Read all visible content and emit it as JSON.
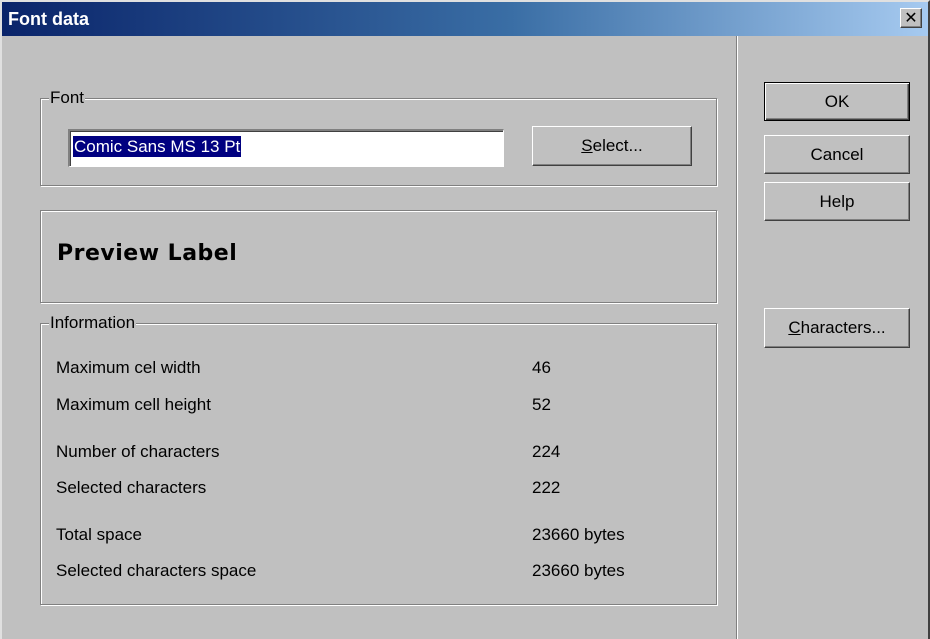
{
  "window": {
    "title": "Font data",
    "close_glyph": "✕"
  },
  "font_group": {
    "label": "Font",
    "font_value": "Comic Sans MS 13 Pt",
    "select_button": {
      "pre": "",
      "accel": "S",
      "post": "elect..."
    }
  },
  "preview": {
    "text": "Preview Label"
  },
  "info_group": {
    "label": "Information",
    "rows": [
      {
        "label": "Maximum cel width",
        "value": "46"
      },
      {
        "label": "Maximum cell height",
        "value": "52"
      },
      {
        "label": "Number of characters",
        "value": "224"
      },
      {
        "label": "Selected characters",
        "value": "222"
      },
      {
        "label": "Total space",
        "value": "23660 bytes"
      },
      {
        "label": "Selected characters space",
        "value": "23660 bytes"
      }
    ]
  },
  "buttons": {
    "ok": "OK",
    "cancel": "Cancel",
    "help": "Help",
    "characters": {
      "accel": "C",
      "post": "haracters..."
    }
  }
}
